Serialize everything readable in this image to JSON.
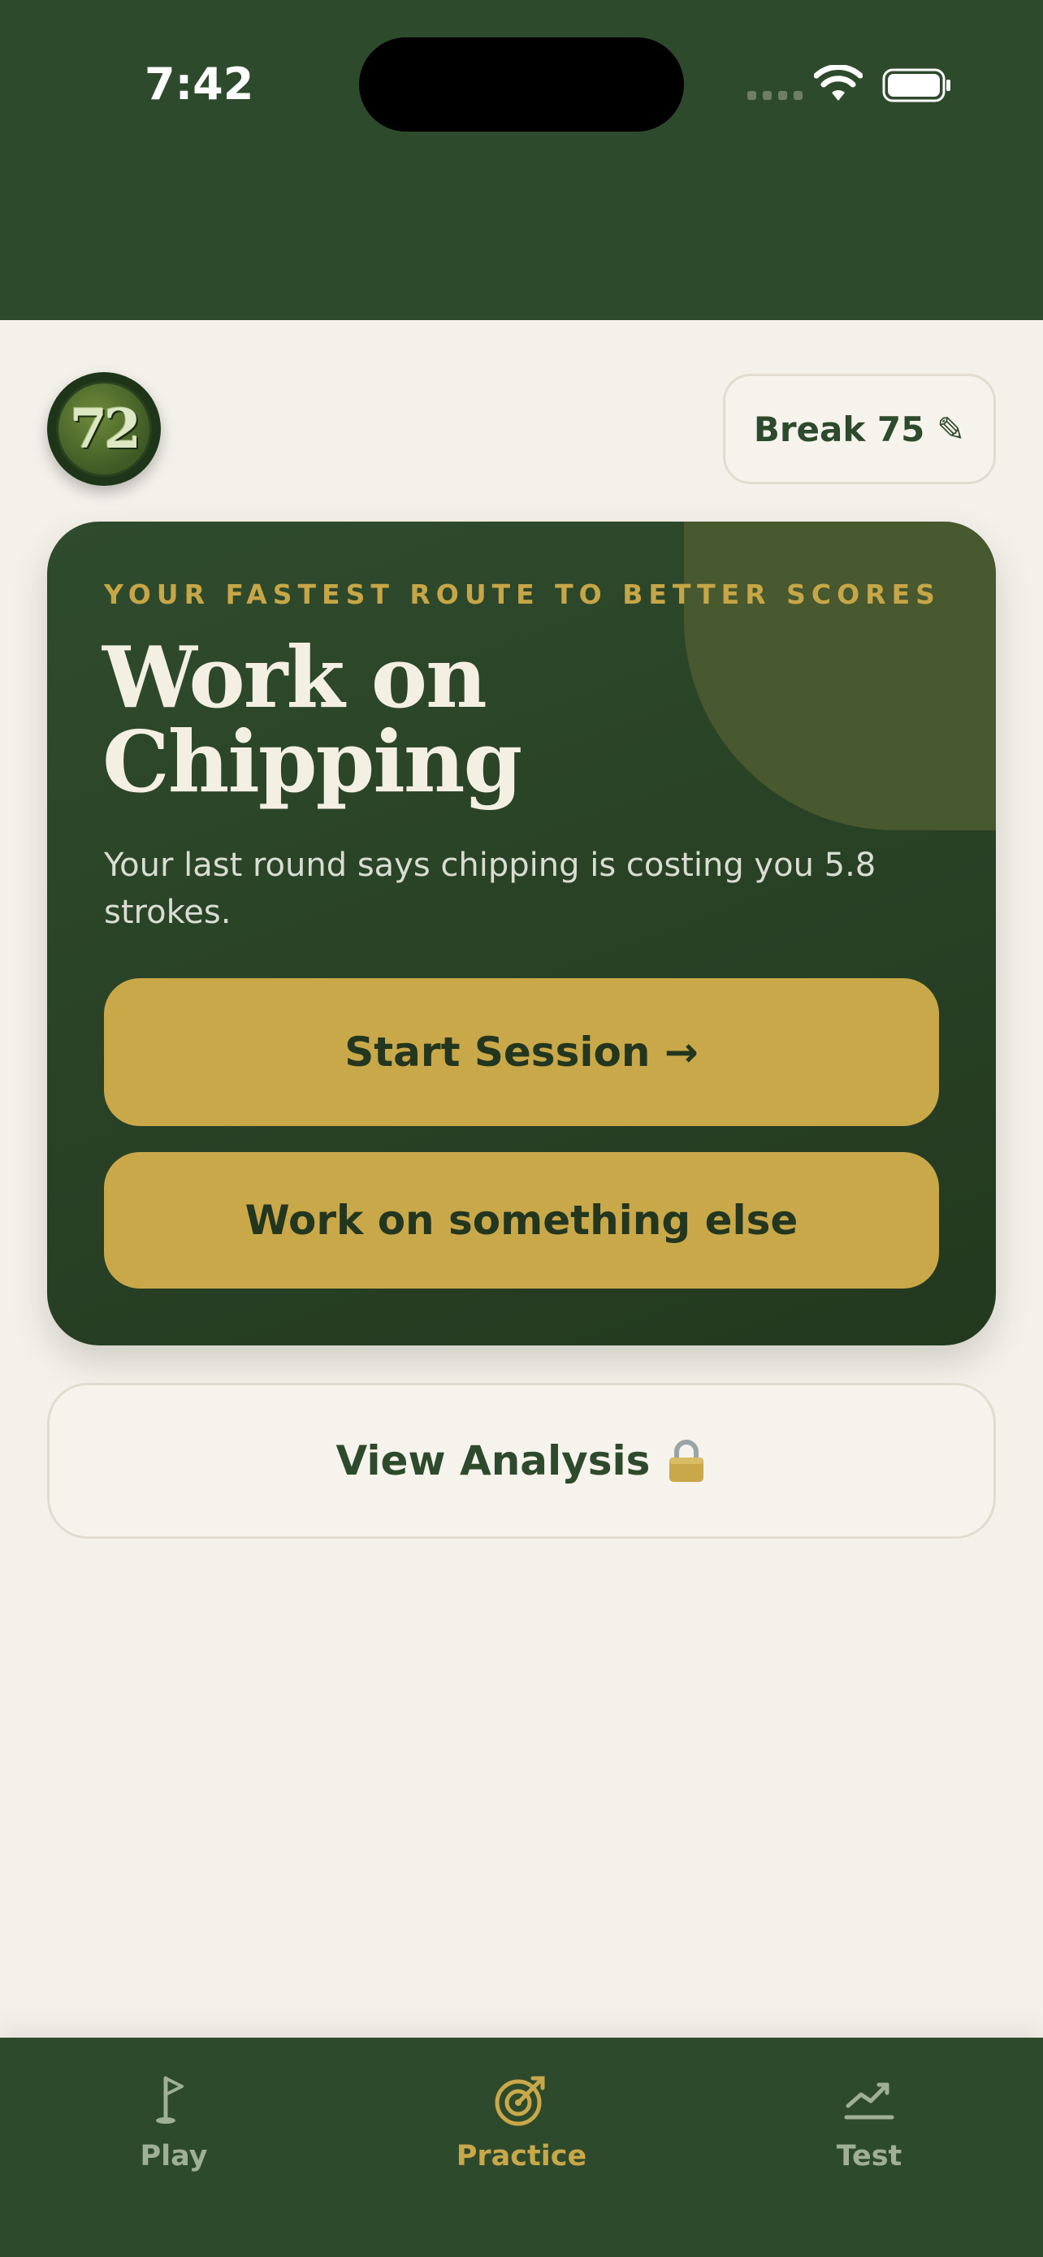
{
  "status_bar": {
    "time": "7:42"
  },
  "profile": {
    "avatar_text": "72",
    "goal_label": "Break 75 ✎"
  },
  "hero": {
    "kicker": "YOUR FASTEST ROUTE TO BETTER SCORES",
    "title_line1": "Work on",
    "title_line2": "Chipping",
    "subtitle": "Your last round says chipping is costing you 5.8 strokes.",
    "primary_button": "Start Session →",
    "secondary_button": "Work on something else"
  },
  "analysis": {
    "label": "View Analysis"
  },
  "tabbar": {
    "tabs": [
      {
        "label": "Play",
        "icon": "flag-icon",
        "active": false
      },
      {
        "label": "Practice",
        "icon": "target-icon",
        "active": true
      },
      {
        "label": "Test",
        "icon": "trend-icon",
        "active": false
      }
    ]
  },
  "colors": {
    "brand_green": "#2E4A2C",
    "accent_gold": "#C9A84A",
    "background": "#F4F1EA"
  }
}
